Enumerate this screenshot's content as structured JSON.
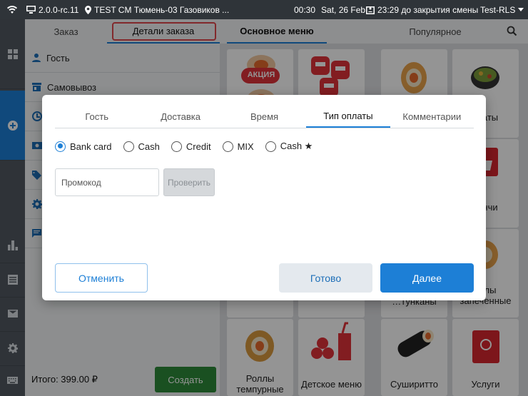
{
  "status": {
    "version": "2.0.0-rc.11",
    "location": "TEST CM Тюмень-03 Газовиков ...",
    "time": "00:30",
    "date": "Sat, 26 Feb",
    "shift": "23:29 до закрытия смены",
    "profile": "Test-RLS"
  },
  "left": {
    "tabs": [
      "Заказ",
      "Детали заказа"
    ],
    "rows": [
      "Гость",
      "Самовывоз"
    ],
    "total": "Итого: 399.00 ₽",
    "create_label": "Создать"
  },
  "menu": {
    "tabs": [
      "Основное меню",
      "Популярное"
    ],
    "tiles": [
      {
        "label": ""
      },
      {
        "label": ""
      },
      {
        "label": ""
      },
      {
        "label": "…аты"
      },
      {
        "label": "…нчи"
      },
      {
        "label": "…лы запеченные"
      },
      {
        "label": "…тунканы"
      },
      {
        "label": "Роллы темпурные"
      },
      {
        "label": "Детское меню"
      },
      {
        "label": "Суширитто"
      },
      {
        "label": "Услуги"
      }
    ],
    "promo_badge": "АКЦИЯ"
  },
  "modal": {
    "tabs": [
      "Гость",
      "Доставка",
      "Время",
      "Тип оплаты",
      "Комментарии"
    ],
    "active_tab": "Тип оплаты",
    "payment_options": [
      "Bank card",
      "Cash",
      "Credit",
      "MIX",
      "Cash ★"
    ],
    "selected_payment": "Bank card",
    "promo_placeholder": "Промокод",
    "check_label": "Проверить",
    "cancel_label": "Отменить",
    "done_label": "Готово",
    "next_label": "Далее"
  },
  "colors": {
    "accent": "#1d7fd6",
    "create_green": "#2e8b3a",
    "highlight_red": "#e0474c"
  }
}
